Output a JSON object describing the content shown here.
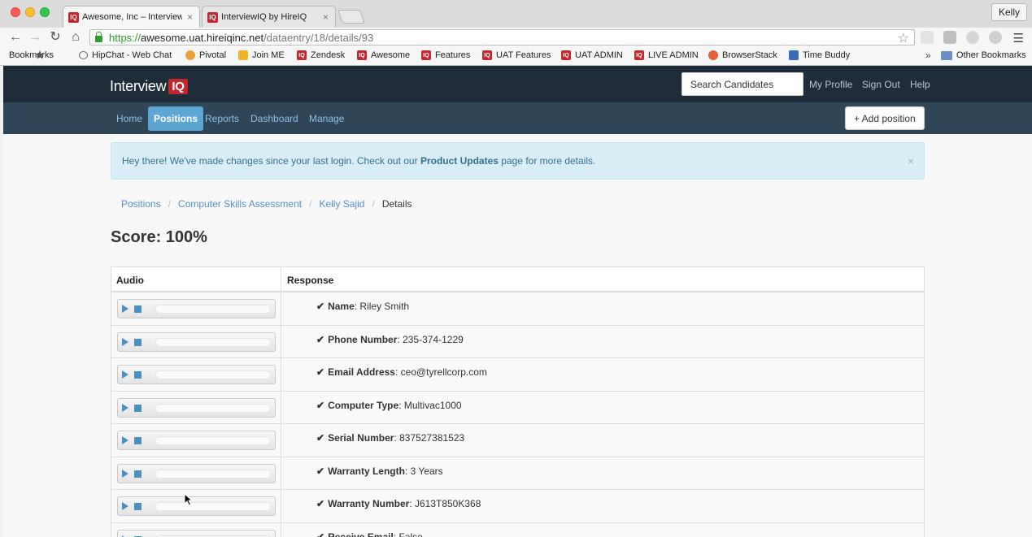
{
  "browser": {
    "tabs": [
      {
        "title": "Awesome, Inc – InterviewIQ",
        "favicon": "IQ"
      },
      {
        "title": "InterviewIQ by HireIQ",
        "favicon": "IQ"
      }
    ],
    "close_glyph": "×",
    "profile_name": "Kelly",
    "url": {
      "scheme": "https://",
      "host": "awesome.uat.hireiqinc.net",
      "path": "/dataentry/18/details/93"
    },
    "bookmarks": [
      {
        "label": "Bookmarks",
        "icon": "star-icon"
      },
      {
        "label": "HipChat - Web Chat",
        "icon": "chat-icon"
      },
      {
        "label": "Pivotal",
        "icon": "pivotal-icon"
      },
      {
        "label": "Join ME",
        "icon": "join-me-icon"
      },
      {
        "label": "Zendesk",
        "icon": "iq-icon"
      },
      {
        "label": "Awesome",
        "icon": "iq-icon"
      },
      {
        "label": "Features",
        "icon": "iq-icon"
      },
      {
        "label": "UAT Features",
        "icon": "iq-icon"
      },
      {
        "label": "UAT ADMIN",
        "icon": "iq-icon"
      },
      {
        "label": "LIVE ADMIN",
        "icon": "iq-icon"
      },
      {
        "label": "BrowserStack",
        "icon": "browserstack-icon"
      },
      {
        "label": "Time Buddy",
        "icon": "time-buddy-icon"
      }
    ],
    "more_glyph": "»",
    "other_bookmarks": "Other Bookmarks"
  },
  "app": {
    "brand": {
      "text": "Interview",
      "badge": "IQ"
    },
    "search_placeholder": "Search Candidates",
    "top_links": [
      "My Profile",
      "Sign Out",
      "Help"
    ],
    "nav": [
      "Home",
      "Positions",
      "Reports",
      "Dashboard",
      "Manage"
    ],
    "active_nav": "Positions",
    "add_button": "+ Add position"
  },
  "alert": {
    "prefix": "Hey there! We've made changes since your last login. Check out our ",
    "link": "Product Updates",
    "suffix": " page for more details.",
    "close": "×"
  },
  "breadcrumb": [
    "Positions",
    "Computer Skills Assessment",
    "Kelly Sajid",
    "Details"
  ],
  "score": "Score: 100%",
  "table": {
    "headers": {
      "audio": "Audio",
      "response": "Response"
    },
    "rows": [
      {
        "label": "Name",
        "value": "Riley Smith"
      },
      {
        "label": "Phone Number",
        "value": "235-374-1229"
      },
      {
        "label": "Email Address",
        "value": "ceo@tyrellcorp.com"
      },
      {
        "label": "Computer Type",
        "value": "Multivac1000"
      },
      {
        "label": "Serial Number",
        "value": "837527381523"
      },
      {
        "label": "Warranty Length",
        "value": "3 Years"
      },
      {
        "label": "Warranty Number",
        "value": "J613T850K368"
      },
      {
        "label": "Receive Email",
        "value": "False"
      }
    ],
    "label_suffix": ": ",
    "check_glyph": "✔"
  },
  "colors": {
    "nav_dark": "#1f2d3a",
    "subnav": "#2f4558",
    "active_tab": "#5ba7d1",
    "link": "#5a8fc4",
    "brand_red": "#c1272d",
    "alert_bg": "#d9edf7"
  }
}
